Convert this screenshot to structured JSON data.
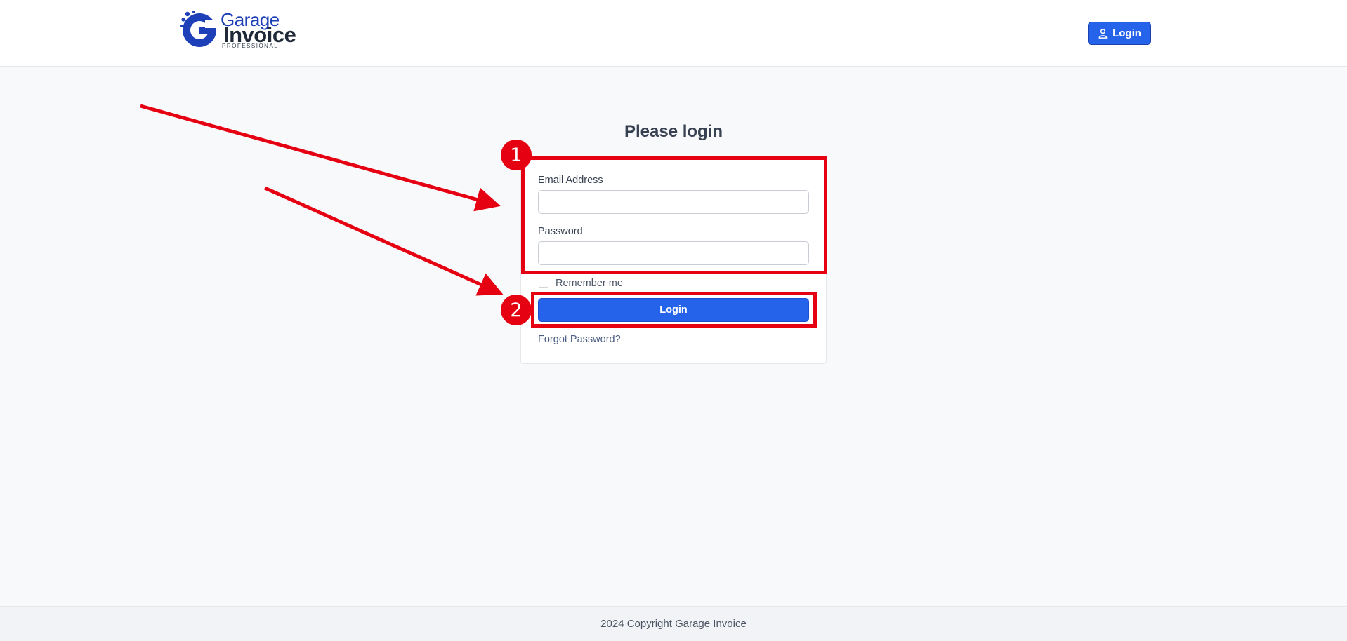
{
  "brand": {
    "line1": "Garage",
    "line2": "Invoice",
    "line3": "PROFESSIONAL",
    "color": "#1d3fb8"
  },
  "nav": {
    "login_label": "Login",
    "login_icon": "user-icon"
  },
  "form": {
    "title": "Please login",
    "email_label": "Email Address",
    "email_value": "",
    "password_label": "Password",
    "password_value": "",
    "remember_label": "Remember me",
    "remember_checked": false,
    "submit_label": "Login",
    "forgot_label": "Forgot Password?"
  },
  "footer": {
    "copyright": "2024 Copyright Garage Invoice"
  },
  "annotations": {
    "badge1": "1",
    "badge2": "2",
    "color": "#e50012"
  },
  "colors": {
    "primary": "#2563eb",
    "background": "#f8f9fb"
  }
}
